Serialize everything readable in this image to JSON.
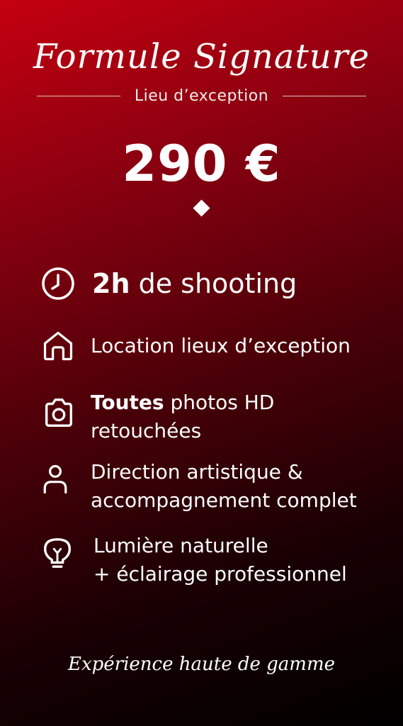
{
  "card": {
    "title": "Formule Signature",
    "subtitle": "Lieu d’exception",
    "price": "290 €",
    "features": [
      {
        "icon": "clock-icon",
        "bold": "2h",
        "rest": " de shooting"
      },
      {
        "icon": "home-icon",
        "bold": "",
        "rest": "Location lieux d’exception"
      },
      {
        "icon": "camera-icon",
        "bold": "Toutes",
        "rest": " photos HD",
        "line2": "retouchées"
      },
      {
        "icon": "user-icon",
        "bold": "",
        "rest": "Direction artistique &",
        "line2": "accompagnement complet"
      },
      {
        "icon": "lightbulb-icon",
        "bold": "",
        "rest": "Lumière naturelle",
        "line2": "+ éclairage professionnel"
      }
    ],
    "tagline": "Expérience haute de gamme"
  },
  "colors": {
    "gradient_start": "#c40010",
    "gradient_end": "#000000",
    "text": "#ffffff"
  }
}
